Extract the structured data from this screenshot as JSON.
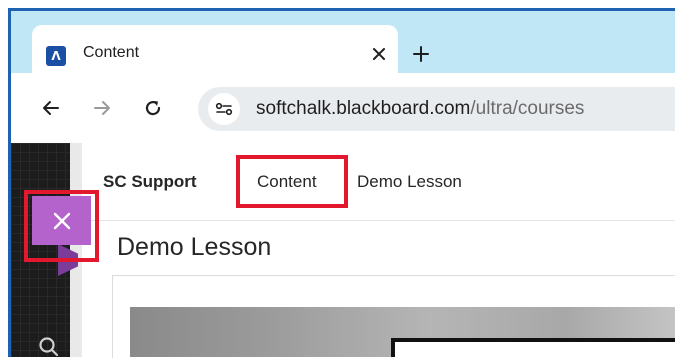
{
  "browser": {
    "tab": {
      "title": "Content",
      "favicon": "blackboard-logo-icon",
      "favicon_letter": "Λ"
    },
    "new_tab_icon": "plus-icon",
    "address_bar": {
      "host": "softchalk.blackboard.com",
      "path": "/ultra/courses",
      "site_info_icon": "site-settings-icon"
    },
    "nav_icons": [
      "back-arrow-icon",
      "forward-arrow-icon",
      "reload-icon"
    ]
  },
  "page": {
    "breadcrumbs": [
      "SC Support",
      "Content",
      "Demo Lesson"
    ],
    "heading": "Demo Lesson",
    "close_icon": "close-icon"
  },
  "colors": {
    "highlight": "#e3172d",
    "close_button": "#b463cc",
    "tabstrip": "#bfe7f5",
    "window_border": "#1f62b2"
  }
}
